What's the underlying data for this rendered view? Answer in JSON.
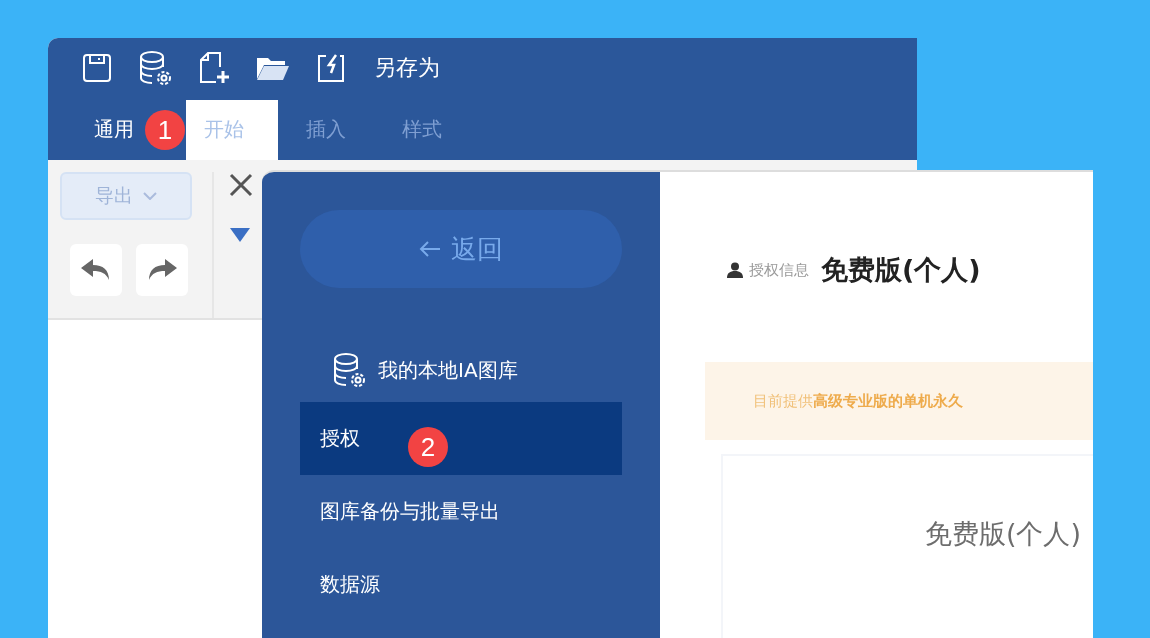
{
  "back_window": {
    "save_as_label": "另存为",
    "tabs": [
      {
        "label": "通用",
        "selected": false
      },
      {
        "label": "开始",
        "selected": true
      },
      {
        "label": "插入",
        "selected": false
      },
      {
        "label": "样式",
        "selected": false
      }
    ],
    "export_button": "导出"
  },
  "front_window": {
    "back_button": "返回",
    "nav": [
      {
        "label": "我的本地IA图库",
        "kind": "library",
        "selected": false
      },
      {
        "label": "授权",
        "kind": "plain",
        "selected": true
      },
      {
        "label": "图库备份与批量导出",
        "kind": "plain",
        "selected": false
      },
      {
        "label": "数据源",
        "kind": "plain",
        "selected": false
      }
    ],
    "content": {
      "title_label": "授权信息",
      "title_value": "免费版(个人)",
      "notice": "目前提供**高级专业版的单机永久**",
      "plan_name": "免费版(个人)"
    }
  },
  "callouts": [
    {
      "number": "1"
    },
    {
      "number": "2"
    }
  ]
}
